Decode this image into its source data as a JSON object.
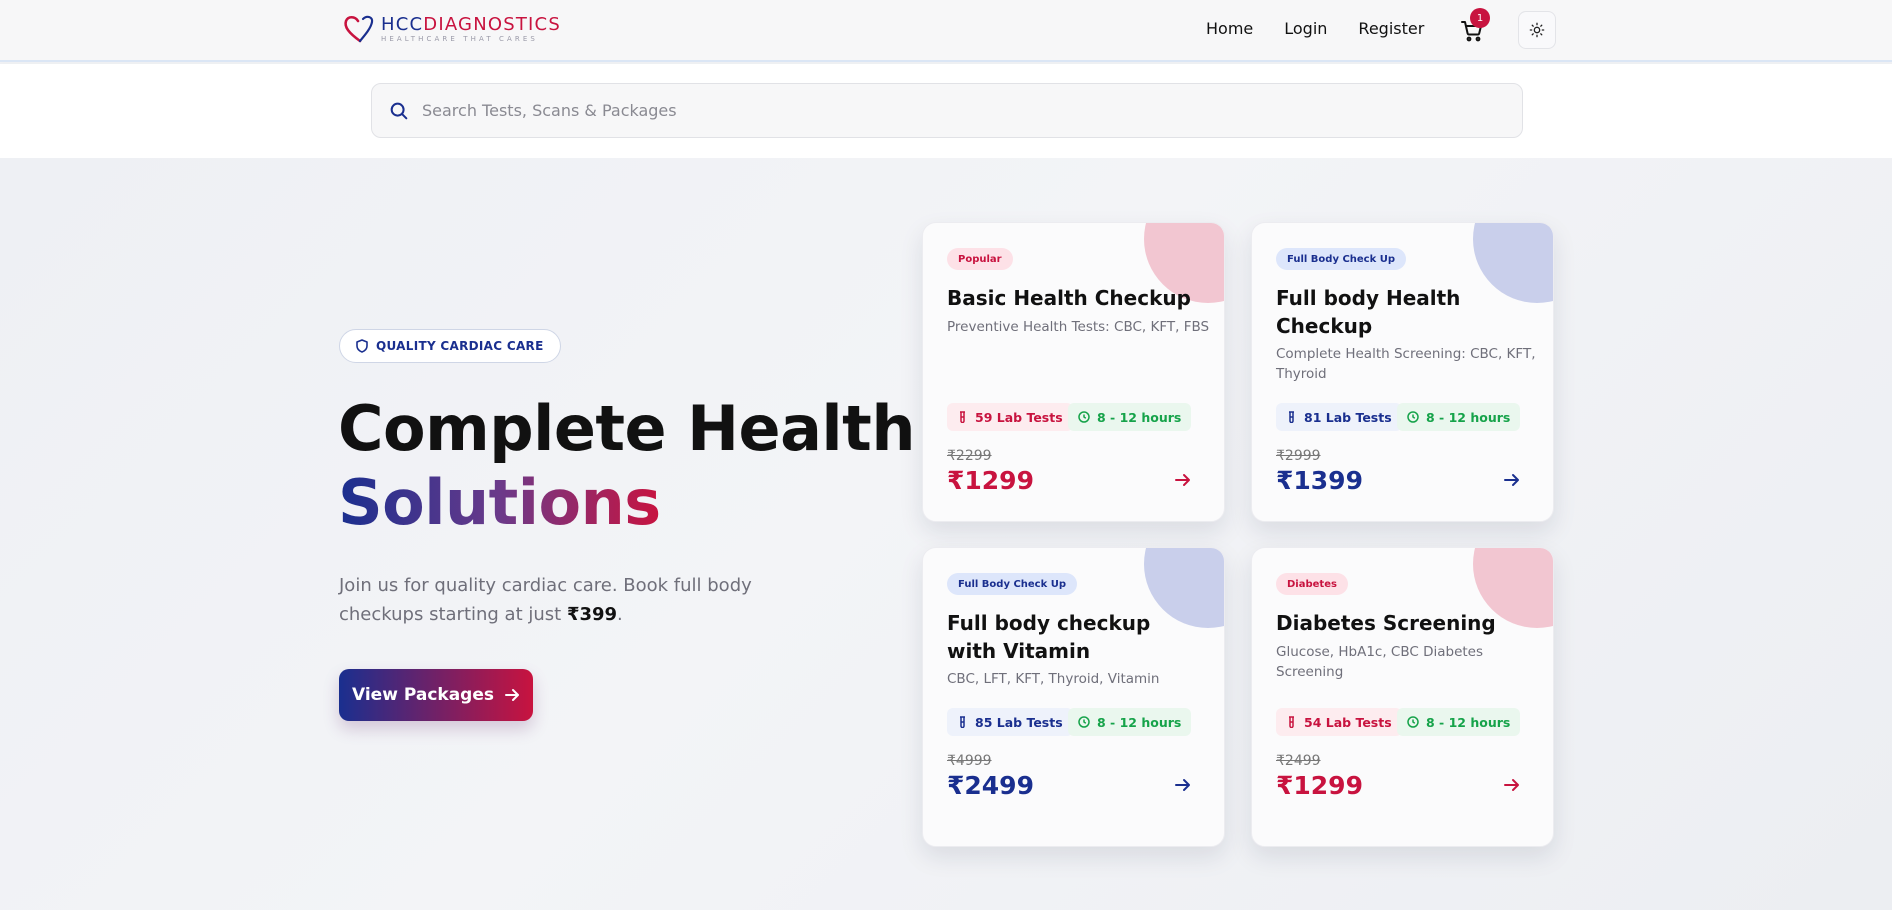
{
  "brand": {
    "name_prefix": "HCC",
    "name_suffix": "DIAGNOSTICS",
    "tagline": "HEALTHCARE THAT CARES"
  },
  "nav": {
    "home": "Home",
    "login": "Login",
    "register": "Register",
    "cart_count": "1"
  },
  "search": {
    "placeholder": "Search Tests, Scans & Packages"
  },
  "hero": {
    "badge": "QUALITY CARDIAC CARE",
    "title_line1": "Complete Health",
    "title_line2": "Solutions",
    "desc_prefix": "Join us for quality cardiac care. Book full body checkups starting at just ",
    "desc_price": "₹399",
    "desc_suffix": ".",
    "cta": "View Packages"
  },
  "colors": {
    "brand_blue": "#1a2f8f",
    "brand_red": "#c8133f",
    "time_green": "#16a34a"
  },
  "packages": [
    {
      "tag": "Popular",
      "title": "Basic Health Checkup",
      "desc": "Preventive Health Tests: CBC, KFT, FBS",
      "lab_tests": "59 Lab Tests",
      "turnaround": "8 - 12 hours",
      "old_price": "₹2299",
      "price": "₹1299",
      "accent": "pink"
    },
    {
      "tag": "Full Body Check Up",
      "title": "Full body Health Checkup",
      "desc": "Complete Health Screening: CBC, KFT, Thyroid",
      "lab_tests": "81 Lab Tests",
      "turnaround": "8 - 12 hours",
      "old_price": "₹2999",
      "price": "₹1399",
      "accent": "blue"
    },
    {
      "tag": "Full Body Check Up",
      "title": "Full body checkup with Vitamin",
      "desc": "CBC, LFT, KFT, Thyroid, Vitamin",
      "lab_tests": "85 Lab Tests",
      "turnaround": "8 - 12 hours",
      "old_price": "₹4999",
      "price": "₹2499",
      "accent": "blue"
    },
    {
      "tag": "Diabetes",
      "title": "Diabetes Screening",
      "desc": "Glucose, HbA1c, CBC Diabetes Screening",
      "lab_tests": "54 Lab Tests",
      "turnaround": "8 - 12 hours",
      "old_price": "₹2499",
      "price": "₹1299",
      "accent": "pink"
    }
  ]
}
